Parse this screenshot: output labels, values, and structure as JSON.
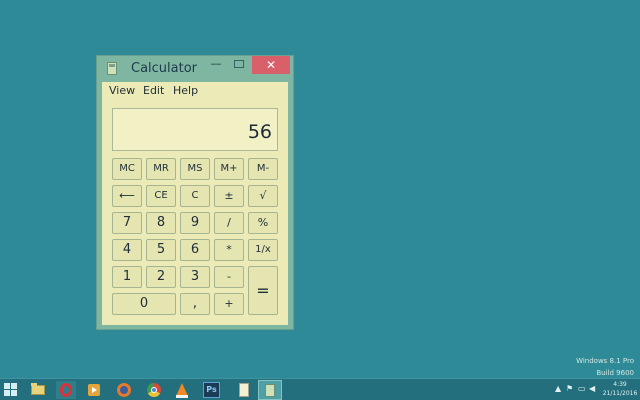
{
  "calculator": {
    "title": "Calculator",
    "titlebar_buttons": {
      "minimize": "—",
      "close": "✕"
    },
    "menu": [
      "View",
      "Edit",
      "Help"
    ],
    "display": "56",
    "keys": {
      "row1": [
        "MC",
        "MR",
        "MS",
        "M+",
        "M-"
      ],
      "row2": [
        "⟵",
        "CE",
        "C",
        "±",
        "√"
      ],
      "row3": [
        "7",
        "8",
        "9",
        "/",
        "%"
      ],
      "row4": [
        "4",
        "5",
        "6",
        "*",
        "1/x"
      ],
      "row5": [
        "1",
        "2",
        "3",
        "-"
      ],
      "row6": [
        "0",
        ",",
        "+"
      ],
      "equals": "="
    }
  },
  "desktop_watermark": {
    "line1": "Windows 8.1 Pro",
    "line2": "Build 9600"
  },
  "taskbar": {
    "apps": [
      "start-icon",
      "file-explorer-icon",
      "opera-icon",
      "media-player-icon",
      "firefox-icon",
      "chrome-icon",
      "vlc-icon",
      "photoshop-icon",
      "notepad-icon",
      "calculator-icon"
    ],
    "photoshop_label": "Ps",
    "tray": {
      "time": "4:39",
      "date": "21/11/2016"
    }
  },
  "colors": {
    "desktop": "#2e8a96",
    "window_frame": "#7fb6a2",
    "client": "#ecebb7",
    "close_button": "#d9606a",
    "taskbar": "#236f7d"
  }
}
